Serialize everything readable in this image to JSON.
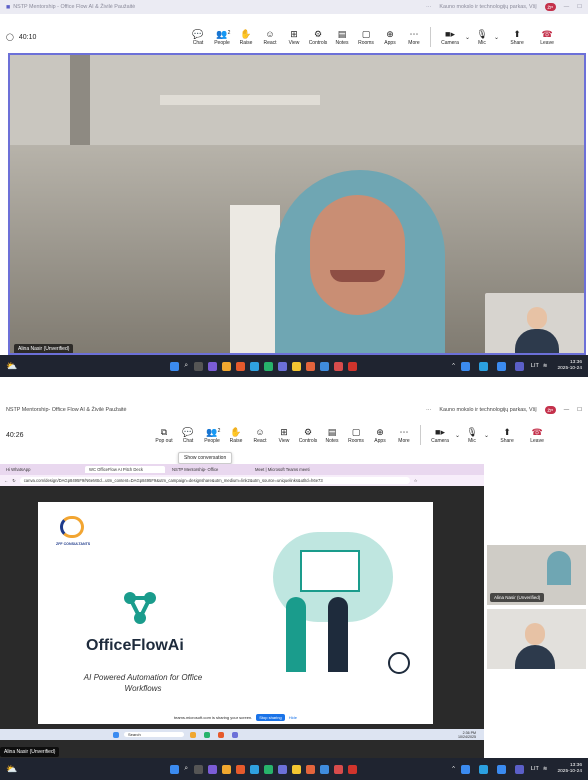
{
  "top": {
    "title": "NSTP Mentorship - Office Flow AI & Živilė Paužaitė",
    "org": "Kauno mokslo ir technologijų parkas, VšĮ",
    "badge": "ŽP",
    "timer": "40:10",
    "toolbar": [
      {
        "id": "chat",
        "label": "Chat",
        "icon": "💬"
      },
      {
        "id": "people",
        "label": "People",
        "icon": "👥"
      },
      {
        "id": "raise",
        "label": "Raise",
        "icon": "✋"
      },
      {
        "id": "react",
        "label": "React",
        "icon": "☺"
      },
      {
        "id": "view",
        "label": "View",
        "icon": "⊞"
      },
      {
        "id": "controls",
        "label": "Controls",
        "icon": "⚙"
      },
      {
        "id": "notes",
        "label": "Notes",
        "icon": "▤"
      },
      {
        "id": "rooms",
        "label": "Rooms",
        "icon": "▢"
      },
      {
        "id": "apps",
        "label": "Apps",
        "icon": "⊕"
      },
      {
        "id": "more",
        "label": "More",
        "icon": "⋯"
      }
    ],
    "people_count": "2",
    "camera_label": "Camera",
    "mic_label": "Mic",
    "share_label": "Share",
    "leave_label": "Leave",
    "participant": "Alina Nasir (Unverified)",
    "time": "13:36",
    "date": "2025-10-24"
  },
  "bottom": {
    "title": "NSTP Mentorship- Office Flow AI & Živilė Paužaitė",
    "org": "Kauno mokslo ir technologijų parkas, VšĮ",
    "badge": "ŽP",
    "timer": "40:26",
    "popout_label": "Pop out",
    "tooltip": "Show conversation",
    "browser_tabs": [
      "Hi WhatsApp",
      "WC OfficeFlow AI Pitch Deck",
      "NSTP Mentorship- Office",
      "Meet | Microsoft Teams meeti"
    ],
    "url": "canva.com/design/DAGp8495F9/N6eMSd...utm_content=DAGp8495F9&utm_campaign=designshare&utm_medium=link2&utm_source=uniquelinks&utlId=h6e73",
    "slide_logo_text": "ZFF CONSULTANTS",
    "slide_title": "OfficeFlowAi",
    "slide_subtitle": "AI Powered Automation for Office Workflows",
    "share_notice": "teams.microsoft.com is sharing your screen.",
    "stop_sharing": "Stop sharing",
    "hide": "Hide",
    "search_placeholder": "Search",
    "tile_name": "Alina Nasir (Unverified)",
    "participant": "Alina Nasir (Unverified)",
    "inner_time": "2:36 PM",
    "inner_date": "10/24/2025",
    "time": "13:36",
    "date": "2025-10-24",
    "lang": "LIT"
  }
}
